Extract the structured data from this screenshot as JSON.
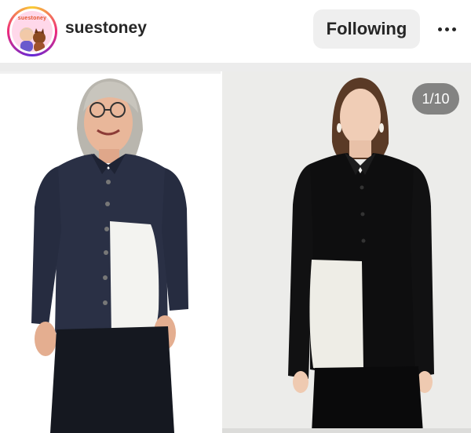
{
  "header": {
    "avatar_text": "suestoney",
    "username": "suestoney",
    "follow_label": "Following"
  },
  "post": {
    "counter": "1/10"
  },
  "colors": {
    "follow_bg": "#efefef",
    "text": "#262626",
    "counter_bg": "#5a5a5a",
    "ring": [
      "#f9ce34",
      "#ee2a7b",
      "#6228d7"
    ]
  },
  "icons": {
    "more": "more-options-icon"
  }
}
